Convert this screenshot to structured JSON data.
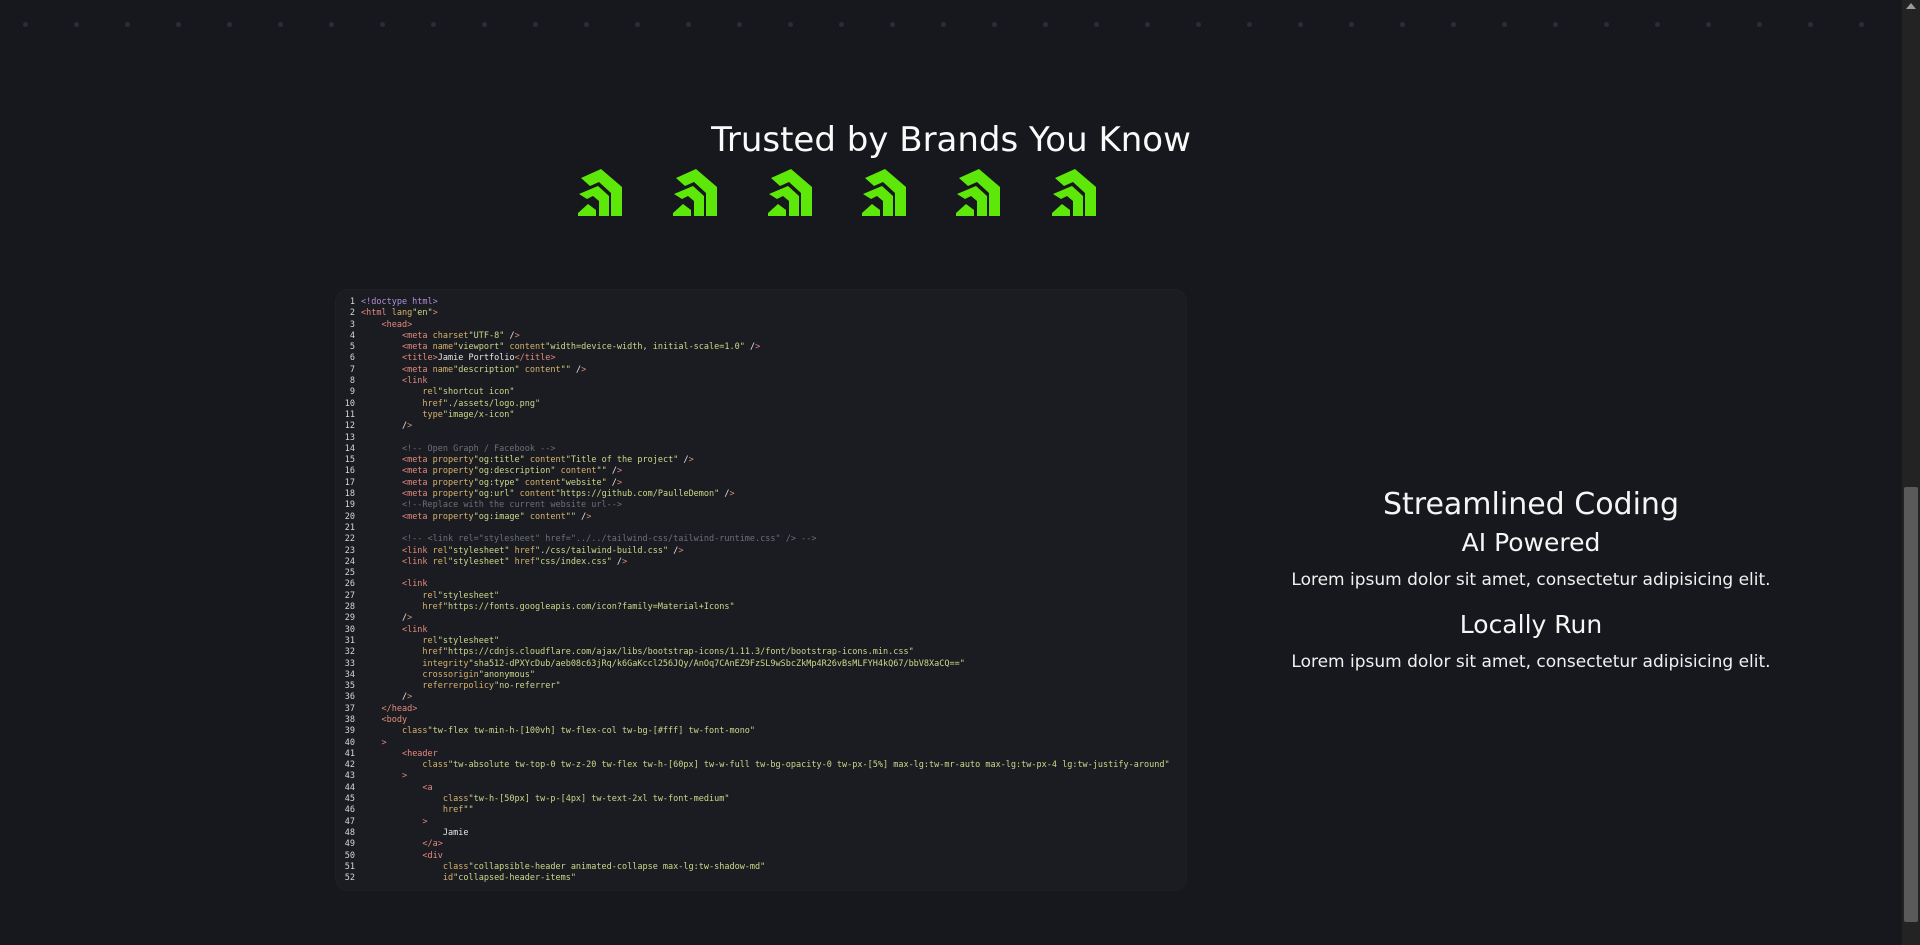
{
  "brands": {
    "title": "Trusted by Brands You Know",
    "logos": [
      "brand-logo-icon",
      "brand-logo-icon",
      "brand-logo-icon",
      "brand-logo-icon",
      "brand-logo-icon",
      "brand-logo-icon"
    ],
    "logo_color": "#5ee80a"
  },
  "code": {
    "lines": [
      "<!doctype html>",
      "<html lang=\"en\">",
      "    <head>",
      "        <meta charset=\"UTF-8\" />",
      "        <meta name=\"viewport\" content=\"width=device-width, initial-scale=1.0\" />",
      "        <title>Jamie Portfolio</title>",
      "        <meta name=\"description\" content=\"\" />",
      "        <link",
      "            rel=\"shortcut icon\"",
      "            href=\"./assets/logo.png\"",
      "            type=\"image/x-icon\"",
      "        />",
      "",
      "        <!-- Open Graph / Facebook -->",
      "        <meta property=\"og:title\" content=\"Title of the project\" />",
      "        <meta property=\"og:description\" content=\"\" />",
      "        <meta property=\"og:type\" content=\"website\" />",
      "        <meta property=\"og:url\" content=\"https://github.com/PaulleDemon\" />",
      "        <!--Replace with the current website url-->",
      "        <meta property=\"og:image\" content=\"\" />",
      "",
      "        <!-- <link rel=\"stylesheet\" href=\"../../tailwind-css/tailwind-runtime.css\" /> -->",
      "        <link rel=\"stylesheet\" href=\"./css/tailwind-build.css\" />",
      "        <link rel=\"stylesheet\" href=\"css/index.css\" />",
      "",
      "        <link",
      "            rel=\"stylesheet\"",
      "            href=\"https://fonts.googleapis.com/icon?family=Material+Icons\"",
      "        />",
      "        <link",
      "            rel=\"stylesheet\"",
      "            href=\"https://cdnjs.cloudflare.com/ajax/libs/bootstrap-icons/1.11.3/font/bootstrap-icons.min.css\"",
      "            integrity=\"sha512-dPXYcDub/aeb08c63jRq/k6GaKccl256JQy/AnOq7CAnEZ9FzSL9wSbcZkMp4R26vBsMLFYH4kQ67/bbV8XaCQ==\"",
      "            crossorigin=\"anonymous\"",
      "            referrerpolicy=\"no-referrer\"",
      "        />",
      "    </head>",
      "    <body",
      "        class=\"tw-flex tw-min-h-[100vh] tw-flex-col tw-bg-[#fff] tw-font-mono\"",
      "    >",
      "        <header",
      "            class=\"tw-absolute tw-top-0 tw-z-20 tw-flex tw-h-[60px] tw-w-full tw-bg-opacity-0 tw-px-[5%] max-lg:tw-mr-auto max-lg:tw-px-4 lg:tw-justify-around\"",
      "        >",
      "            <a",
      "                class=\"tw-h-[50px] tw-p-[4px] tw-text-2xl tw-font-medium\"",
      "                href=\"\"",
      "            >",
      "                Jamie",
      "            </a>",
      "            <div",
      "                class=\"collapsible-header animated-collapse max-lg:tw-shadow-md\"",
      "                id=\"collapsed-header-items\""
    ],
    "colors": {
      "tag": "#e58a7e",
      "attr": "#d7b36b",
      "string": "#c9d98a",
      "comment": "#6b7078",
      "doctype": "#b58fd8",
      "text": "#e6e6e6"
    }
  },
  "features": {
    "title": "Streamlined Coding",
    "items": [
      {
        "title": "AI Powered",
        "description": "Lorem ipsum dolor sit amet, consectetur adipisicing elit."
      },
      {
        "title": "Locally Run",
        "description": "Lorem ipsum dolor sit amet, consectetur adipisicing elit."
      }
    ]
  }
}
